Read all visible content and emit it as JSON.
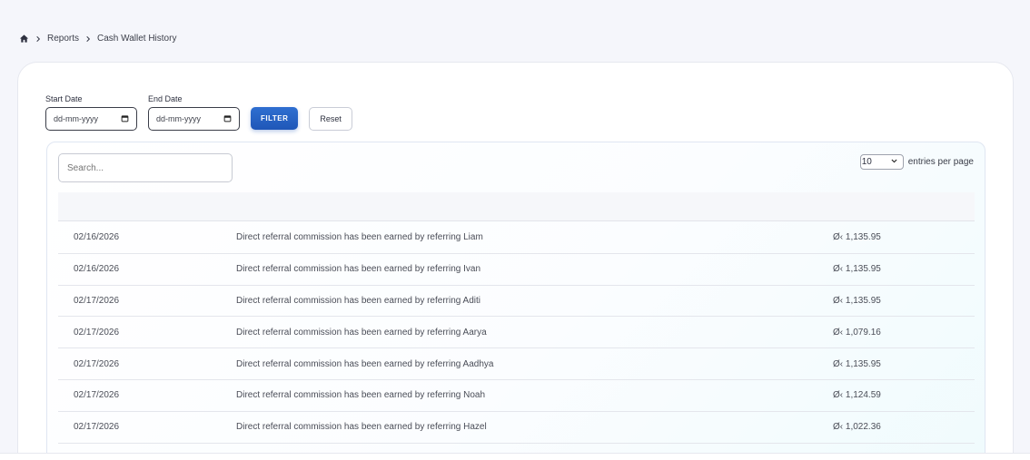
{
  "breadcrumb": {
    "home_icon": "home-icon",
    "items": [
      "Reports",
      "Cash Wallet History"
    ]
  },
  "filters": {
    "start_label": "Start Date",
    "start_value": "dd-mm-yyyy",
    "end_label": "End Date",
    "end_value": "dd-mm-yyyy",
    "filter_button": "FILTER",
    "reset_button": "Reset"
  },
  "table": {
    "search_placeholder": "Search...",
    "entries_value": "10",
    "entries_label": "entries per page",
    "rows": [
      {
        "date": "02/16/2026",
        "description": "Direct referral commission has been earned by referring Liam",
        "amount": "Ø‹ 1,135.95"
      },
      {
        "date": "02/16/2026",
        "description": "Direct referral commission has been earned by referring Ivan",
        "amount": "Ø‹ 1,135.95"
      },
      {
        "date": "02/17/2026",
        "description": "Direct referral commission has been earned by referring Aditi",
        "amount": "Ø‹ 1,135.95"
      },
      {
        "date": "02/17/2026",
        "description": "Direct referral commission has been earned by referring Aarya",
        "amount": "Ø‹ 1,079.16"
      },
      {
        "date": "02/17/2026",
        "description": "Direct referral commission has been earned by referring Aadhya",
        "amount": "Ø‹ 1,135.95"
      },
      {
        "date": "02/17/2026",
        "description": "Direct referral commission has been earned by referring Noah",
        "amount": "Ø‹ 1,124.59"
      },
      {
        "date": "02/17/2026",
        "description": "Direct referral commission has been earned by referring Hazel",
        "amount": "Ø‹ 1,022.36"
      }
    ]
  },
  "colors": {
    "accent": "#1f57b8",
    "page_bg": "#f5f6fb"
  }
}
